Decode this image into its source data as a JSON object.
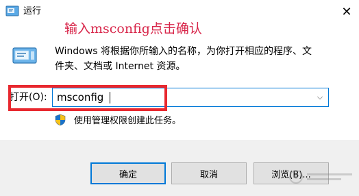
{
  "window": {
    "title": "运行",
    "close_glyph": "✕"
  },
  "annotation": "输入msconfig点击确认",
  "description": {
    "line1": "Windows 将根据你所输入的名称，为你打开相应的程序、文",
    "line2": "件夹、文档或 Internet 资源。"
  },
  "open": {
    "label": "打开(O):",
    "value": "msconfig",
    "dropdown_glyph": "⌵"
  },
  "uac_text": "使用管理权限创建此任务。",
  "buttons": {
    "ok": "确定",
    "cancel": "取消",
    "browse": "浏览(B)..."
  },
  "icons": {
    "title": "run-icon",
    "main": "run-icon",
    "uac": "shield-icon",
    "dropdown": "chevron-down-icon",
    "close": "close-icon"
  },
  "colors": {
    "annotation": "#d8264a",
    "highlight_box": "#e8282f",
    "focus_border": "#0078d7"
  }
}
